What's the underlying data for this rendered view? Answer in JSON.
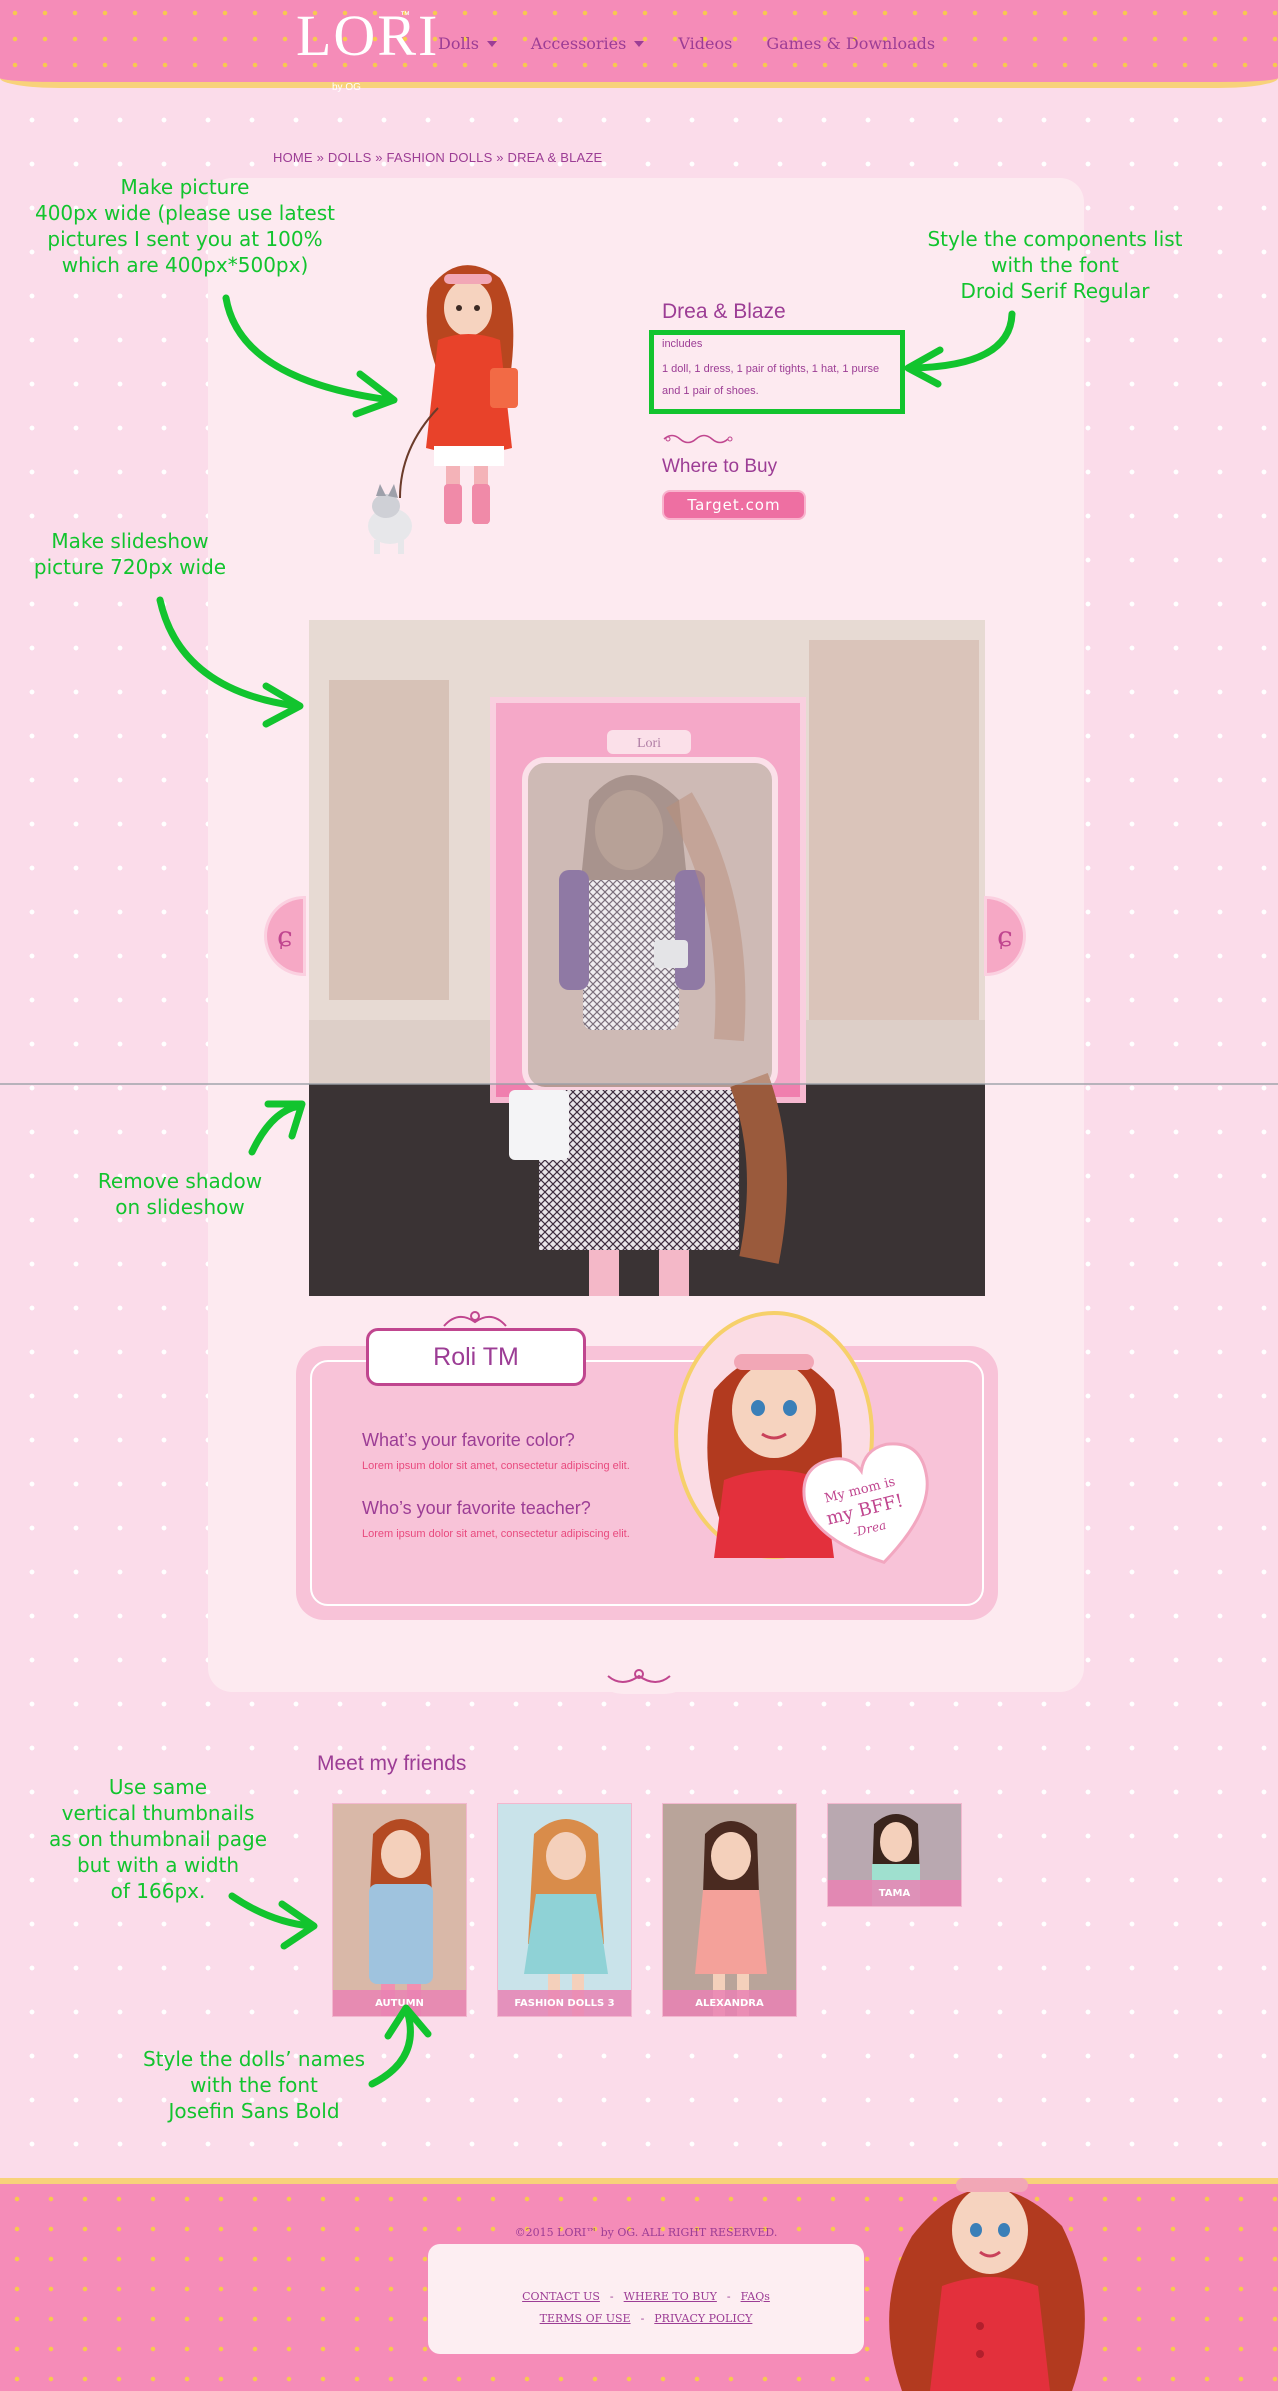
{
  "header": {
    "logo": "LORI",
    "logo_tm": "™",
    "logo_sub": "by OG",
    "nav": [
      {
        "label": "Dolls",
        "dropdown": true
      },
      {
        "label": "Accessories",
        "dropdown": true
      },
      {
        "label": "Videos",
        "dropdown": false
      },
      {
        "label": "Games & Downloads",
        "dropdown": false
      }
    ]
  },
  "breadcrumb": "HOME » DOLLS » FASHION DOLLS » DREA & BLAZE",
  "product": {
    "title": "Drea & Blaze",
    "includes_label": "includes",
    "includes_text": "1 doll, 1 dress, 1 pair of tights, 1 hat, 1 purse and 1 pair of shoes.",
    "where_label": "Where to Buy",
    "buy_button": "Target.com"
  },
  "slideshow": {
    "box_logo": "Lori"
  },
  "qa": {
    "name": "Roli TM",
    "questions": [
      {
        "q": "What’s your favorite color?",
        "a": "Lorem ipsum dolor sit amet, consectetur adipiscing elit."
      },
      {
        "q": "Who’s your favorite teacher?",
        "a": "Lorem ipsum dolor sit amet, consectetur adipiscing elit."
      }
    ],
    "heart_text_1": "My mom is",
    "heart_text_2": "my BFF!",
    "heart_sign": "-Drea"
  },
  "friends": {
    "title": "Meet my friends",
    "items": [
      {
        "label": "AUTUMN"
      },
      {
        "label": "FASHION DOLLS 3"
      },
      {
        "label": "ALEXANDRA"
      },
      {
        "label": "TAMA"
      }
    ]
  },
  "annotations": {
    "picture": "Make picture\n400px wide (please use latest\npictures I sent you at 100%\nwhich are 400px*500px)",
    "components": "Style the components list\nwith the font\nDroid Serif Regular",
    "slideshow": "Make slideshow\npicture 720px wide",
    "shadow": "Remove shadow\non slideshow",
    "thumbnails": "Use same\nvertical thumbnails\nas on thumbnail page\nbut with a width\nof 166px.",
    "names": "Style the dolls’ names\nwith the font\nJosefin Sans Bold",
    "color": "#12c42e"
  },
  "footer": {
    "copyright": "©2015 LORI™ by OG. ALL RIGHT RESERVED.",
    "links_row1": [
      "CONTACT US",
      "WHERE TO BUY",
      "FAQs"
    ],
    "links_row2": [
      "TERMS OF USE",
      "PRIVACY POLICY"
    ]
  }
}
